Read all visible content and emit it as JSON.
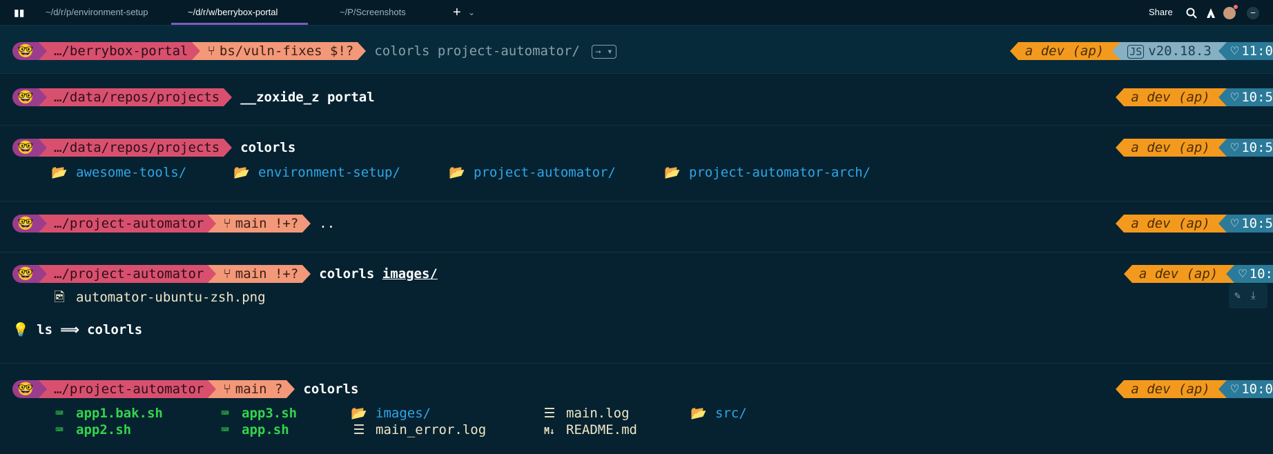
{
  "tabs": [
    {
      "label": "~/d/r/p/environment-setup"
    },
    {
      "label": "~/d/r/w/berrybox-portal"
    },
    {
      "label": "~/P/Screenshots"
    }
  ],
  "tabbar": {
    "new_tab": "+",
    "chevron": "⌄",
    "share_label": "Share",
    "close": "−"
  },
  "prompt_common": {
    "emoji": "🤓",
    "aws": " dev (ap)",
    "aws_icon": "a",
    "heart": "♡"
  },
  "blocks": [
    {
      "path": "…/berrybox-portal",
      "git": "bs/vuln-fixes $!?",
      "command": "colorls project-automator/",
      "node": "v20.18.3",
      "time": "11:0",
      "kbd": "→ ▾"
    },
    {
      "path": "…/data/repos/projects",
      "command": "__zoxide_z portal",
      "time": "10:5"
    },
    {
      "path": "…/data/repos/projects",
      "command": "colorls",
      "time": "10:5",
      "dirs": [
        "awesome-tools/",
        "environment-setup/",
        "project-automator/",
        "project-automator-arch/"
      ]
    },
    {
      "path": "…/project-automator",
      "git": "main !+?",
      "command": "..",
      "time": "10:5"
    },
    {
      "path": "…/project-automator",
      "git": "main !+?",
      "command": "colorls",
      "arg": "images/",
      "time": "10:",
      "file": "automator-ubuntu-zsh.png",
      "hint_bulb": "💡",
      "hint": "ls ⟹ colorls"
    },
    {
      "path": "…/project-automator",
      "git": "main ?",
      "command": "colorls",
      "time": "10:0",
      "items": [
        "app1.bak.sh",
        "app3.sh",
        "images/",
        "main.log",
        "src/",
        "app2.sh",
        "app.sh",
        "main_error.log",
        "README.md"
      ]
    }
  ],
  "colors": {
    "background": "#062230",
    "path": "#d9506e",
    "git": "#f39879",
    "aws": "#f39a1e",
    "node": "#86b0c4",
    "time": "#2b7a99",
    "dir": "#2fa6e7",
    "exe": "#34d34c"
  }
}
